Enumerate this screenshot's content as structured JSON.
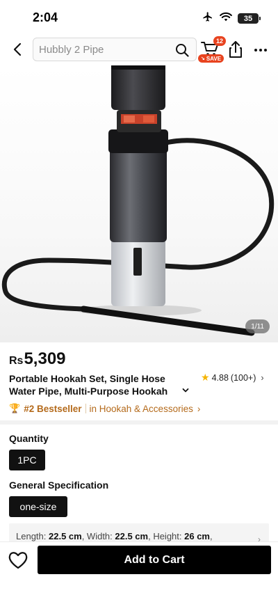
{
  "status_bar": {
    "time": "2:04",
    "battery": "35",
    "icons": [
      "airplane-icon",
      "wifi-icon",
      "battery-icon"
    ]
  },
  "nav": {
    "search_placeholder": "Hubbly 2 Pipe",
    "cart_count": "12",
    "save_label": "SAVE",
    "icons": [
      "back-arrow-icon",
      "search-icon",
      "cart-icon",
      "share-icon",
      "more-icon"
    ]
  },
  "gallery": {
    "counter": "1/11"
  },
  "product": {
    "currency": "Rs",
    "price": "5,309",
    "title_line1": "Portable Hookah Set, Single Hose",
    "title_line2": "Water Pipe, Multi-Purpose Hookah",
    "rating": "4.88",
    "rating_count": "(100+)"
  },
  "bestseller": {
    "rank": "#2 Bestseller",
    "category": "in Hookah & Accessories"
  },
  "options": {
    "quantity_label": "Quantity",
    "quantity_value": "1PC",
    "spec_label": "General Specification",
    "spec_value": "one-size",
    "dimensions": [
      {
        "label": "Length: ",
        "value": "22.5 cm"
      },
      {
        "label": ", Width: ",
        "value": "22.5 cm"
      },
      {
        "label": ", Height: ",
        "value": "26 cm"
      },
      {
        "label": ",",
        "value": ""
      }
    ]
  },
  "bottom": {
    "add_to_cart": "Add to Cart"
  },
  "colors": {
    "accent": "#e8431f",
    "bestseller": "#b46a1b",
    "primary_button": "#000000",
    "rating_star": "#f5b400"
  }
}
